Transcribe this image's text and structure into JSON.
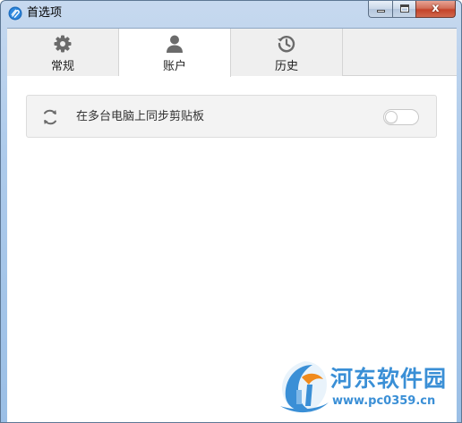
{
  "window": {
    "title": "首选项",
    "close_glyph": "x"
  },
  "tabs": [
    {
      "label": "常规",
      "icon": "gear-icon",
      "active": false
    },
    {
      "label": "账户",
      "icon": "user-icon",
      "active": true
    },
    {
      "label": "历史",
      "icon": "history-icon",
      "active": false
    }
  ],
  "account": {
    "sync_label": "在多台电脑上同步剪贴板",
    "sync_icon": "sync-icon",
    "sync_enabled": false
  },
  "watermark": {
    "name": "河东软件园",
    "url": "www.pc0359.cn"
  },
  "colors": {
    "accent": "#3a8fd6",
    "icon_gray": "#6b6b6b"
  }
}
